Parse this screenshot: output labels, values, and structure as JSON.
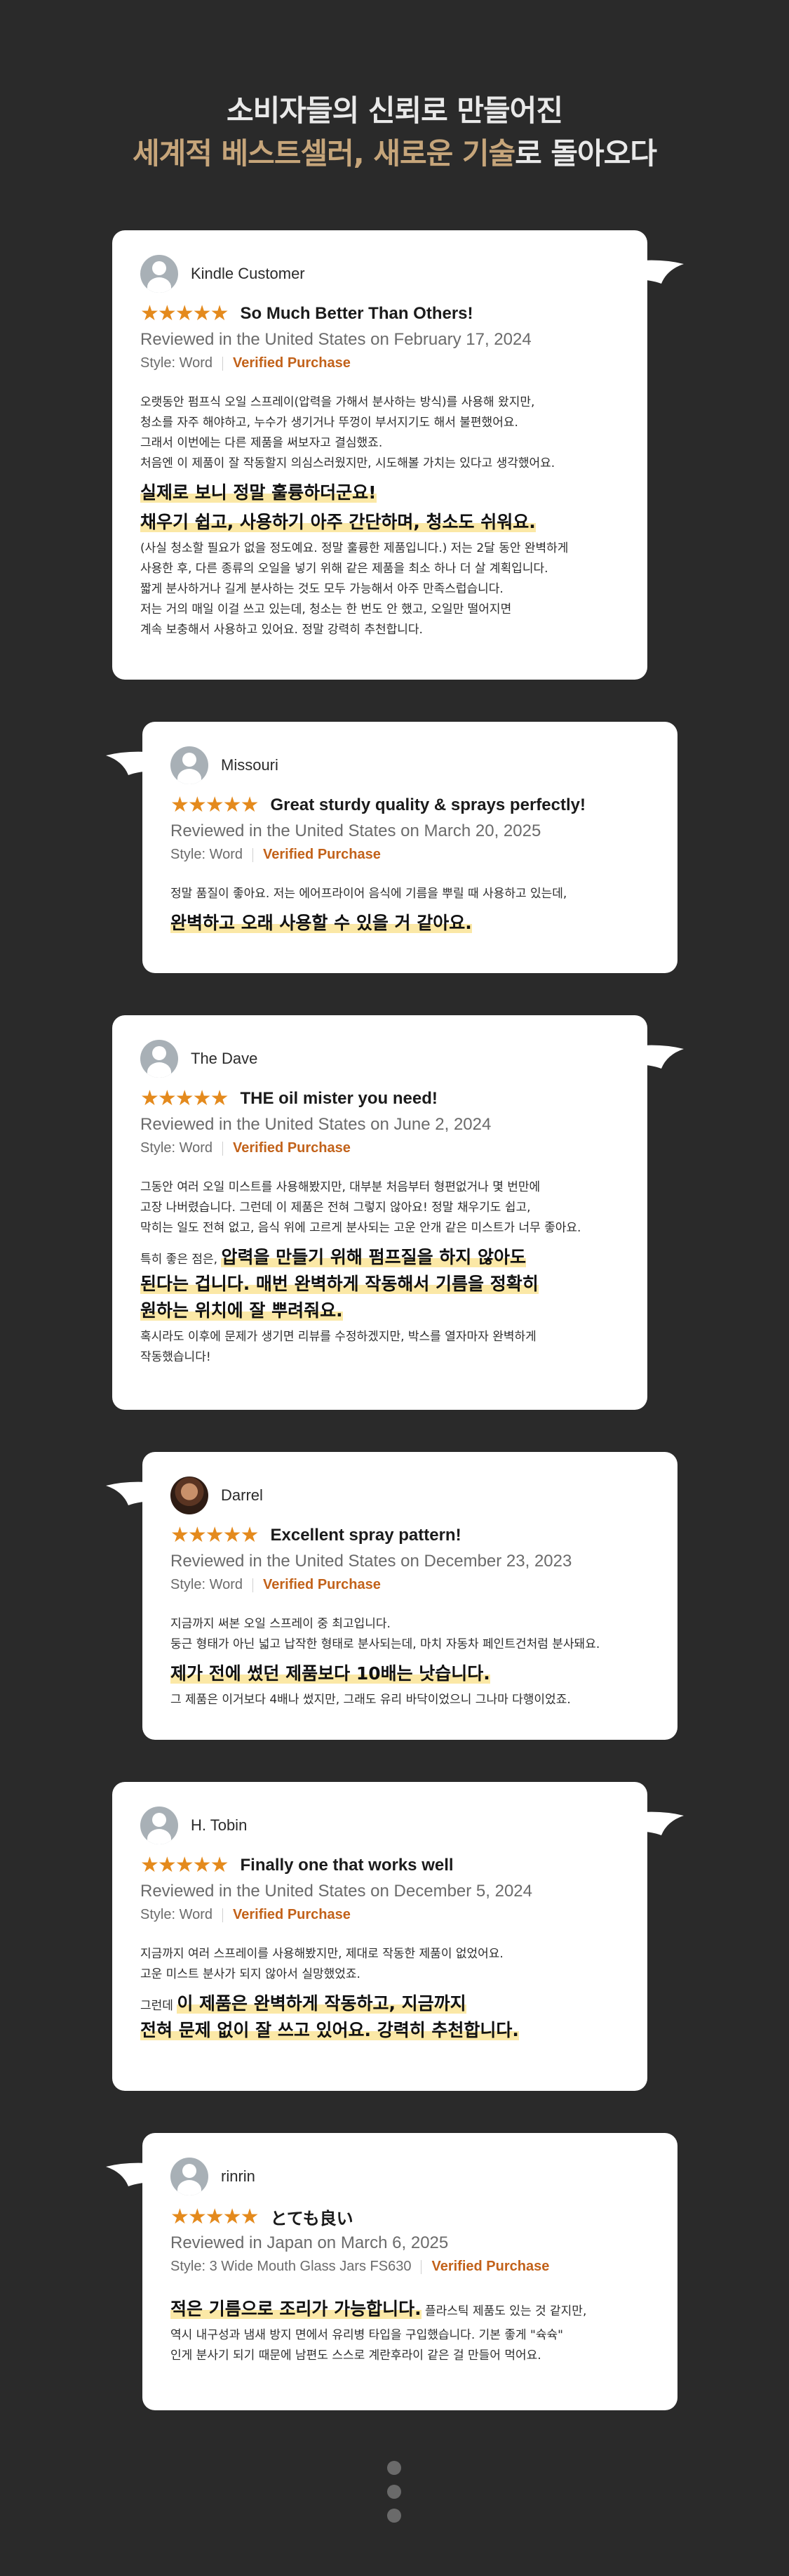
{
  "header": {
    "line1": "소비자들의 신뢰로 만들어진",
    "line2_gold": "세계적 베스트셀러, 새로운 기술",
    "line2_white": "로 돌아오다"
  },
  "reviews": [
    {
      "user": "Kindle Customer",
      "stars": "★★★★★",
      "title": "So Much Better Than Others!",
      "reviewed": "Reviewed in the United States on February 17, 2024",
      "style": "Style: Word",
      "verified": "Verified Purchase",
      "p1": "오랫동안 펌프식 오일 스프레이(압력을 가해서 분사하는 방식)를 사용해 왔지만,\n청소를 자주 해야하고, 누수가 생기거나 뚜껑이 부서지기도 해서 불편했어요.\n그래서 이번에는 다른 제품을 써보자고 결심했죠.\n처음엔 이 제품이 잘 작동할지 의심스러웠지만, 시도해볼 가치는 있다고 생각했어요.",
      "h1": "실제로 보니 정말 훌륭하더군요!",
      "h2": "채우기 쉽고, 사용하기 아주 간단하며, 청소도 쉬워요.",
      "p2": "(사실 청소할 필요가 없을 정도예요. 정말 훌륭한 제품입니다.) 저는 2달 동안 완벽하게\n사용한 후, 다른 종류의 오일을 넣기 위해 같은 제품을 최소 하나 더 살 계획입니다.\n짧게 분사하거나 길게 분사하는 것도 모두 가능해서 아주 만족스럽습니다.\n저는 거의 매일 이걸 쓰고 있는데, 청소는 한 번도 안 했고, 오일만 떨어지면\n계속 보충해서 사용하고 있어요. 정말 강력히 추천합니다."
    },
    {
      "user": "Missouri",
      "stars": "★★★★★",
      "title": "Great sturdy quality & sprays perfectly!",
      "reviewed": "Reviewed in the United States on March 20, 2025",
      "style": "Style: Word",
      "verified": "Verified Purchase",
      "p1": "정말 품질이 좋아요. 저는 에어프라이어 음식에 기름을 뿌릴 때 사용하고 있는데,",
      "h1": "완벽하고 오래 사용할 수 있을 거 같아요."
    },
    {
      "user": "The Dave",
      "stars": "★★★★★",
      "title": "THE oil mister you need!",
      "reviewed": "Reviewed in the United States on June 2, 2024",
      "style": "Style: Word",
      "verified": "Verified Purchase",
      "p1": "그동안 여러 오일 미스트를 사용해봤지만, 대부분 처음부터 형편없거나 몇 번만에\n고장 나버렸습니다. 그런데 이 제품은 전혀 그렇지 않아요! 정말 채우기도 쉽고,\n막히는 일도 전혀 없고, 음식 위에 고르게 분사되는 고운 안개 같은 미스트가 너무 좋아요.",
      "lead": "특히 좋은 점은, ",
      "h1": "압력을 만들기 위해 펌프질을 하지 않아도\n된다는 겁니다. 매번 완벽하게 작동해서 기름을 정확히\n원하는 위치에 잘 뿌려줘요.",
      "p2": "혹시라도 이후에 문제가 생기면 리뷰를 수정하겠지만, 박스를 열자마자 완벽하게\n작동했습니다!"
    },
    {
      "user": "Darrel",
      "stars": "★★★★★",
      "title": "Excellent spray pattern!",
      "reviewed": "Reviewed in the United States on December 23, 2023",
      "style": "Style: Word",
      "verified": "Verified Purchase",
      "p1": "지금까지 써본 오일 스프레이 중 최고입니다.\n둥근 형태가 아닌 넓고 납작한 형태로 분사되는데, 마치 자동차 페인트건처럼 분사돼요.",
      "h1": "제가 전에 썼던 제품보다 10배는 낫습니다.",
      "p2": "그 제품은 이거보다 4배나 썼지만, 그래도 유리 바닥이었으니 그나마 다행이었죠."
    },
    {
      "user": "H. Tobin",
      "stars": "★★★★★",
      "title": "Finally one that works well",
      "reviewed": "Reviewed in the United States on December 5, 2024",
      "style": "Style: Word",
      "verified": "Verified Purchase",
      "p1": "지금까지 여러 스프레이를 사용해봤지만, 제대로 작동한 제품이 없었어요.\n고운 미스트 분사가 되지 않아서 실망했었죠.",
      "lead": "그런데 ",
      "h1": "이 제품은 완벽하게 작동하고, 지금까지\n전혀 문제 없이 잘 쓰고 있어요. 강력히 추천합니다."
    },
    {
      "user": "rinrin",
      "stars": "★★★★★",
      "title": "とても良い",
      "reviewed": "Reviewed in Japan on March 6, 2025",
      "style": "Style: 3 Wide Mouth Glass Jars FS630",
      "verified": "Verified Purchase",
      "h1": "적은 기름으로 조리가 가능합니다.",
      "tail": " 플라스틱 제품도 있는 것 같지만,",
      "p2": "역시 내구성과 냄새 방지 면에서 유리병 타입을 구입했습니다. 기본 좋게 \"슉슉\"\n인게 분사기 되기 때문에 남편도 스스로 계란후라이 같은 걸 만들어 먹어요."
    }
  ]
}
